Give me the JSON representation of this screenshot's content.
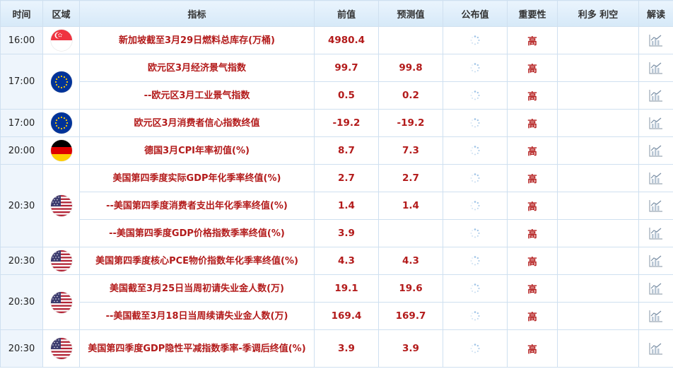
{
  "headers": {
    "time": "时间",
    "region": "区域",
    "indicator": "指标",
    "prev": "前值",
    "forecast": "预测值",
    "actual": "公布值",
    "importance": "重要性",
    "effect": "利多 利空",
    "interpret": "解读"
  },
  "rows": [
    {
      "time": "16:00",
      "flag": "sg-flag-icon",
      "indicator": "新加坡截至3月29日燃料总库存(万桶)",
      "prev": "4980.4",
      "forecast": "",
      "importance": "高"
    },
    {
      "time": "17:00",
      "flag": "eu-flag-icon",
      "indicator": "欧元区3月经济景气指数",
      "prev": "99.7",
      "forecast": "99.8",
      "importance": "高"
    },
    {
      "indicator": "--欧元区3月工业景气指数",
      "prev": "0.5",
      "forecast": "0.2",
      "importance": "高"
    },
    {
      "time": "17:00",
      "flag": "eu-flag-icon",
      "indicator": "欧元区3月消费者信心指数终值",
      "prev": "-19.2",
      "forecast": "-19.2",
      "importance": "高"
    },
    {
      "time": "20:00",
      "flag": "de-flag-icon",
      "indicator": "德国3月CPI年率初值(%)",
      "prev": "8.7",
      "forecast": "7.3",
      "importance": "高"
    },
    {
      "time": "20:30",
      "flag": "us-flag-icon",
      "indicator": "美国第四季度实际GDP年化季率终值(%)",
      "prev": "2.7",
      "forecast": "2.7",
      "importance": "高"
    },
    {
      "indicator": "--美国第四季度消费者支出年化季率终值(%)",
      "prev": "1.4",
      "forecast": "1.4",
      "importance": "高"
    },
    {
      "indicator": "--美国第四季度GDP价格指数季率终值(%)",
      "prev": "3.9",
      "forecast": "",
      "importance": "高"
    },
    {
      "time": "20:30",
      "flag": "us-flag-icon",
      "indicator": "美国第四季度核心PCE物价指数年化季率终值(%)",
      "prev": "4.3",
      "forecast": "4.3",
      "importance": "高"
    },
    {
      "time": "20:30",
      "flag": "us-flag-icon",
      "indicator": "美国截至3月25日当周初请失业金人数(万)",
      "prev": "19.1",
      "forecast": "19.6",
      "importance": "高"
    },
    {
      "indicator": "--美国截至3月18日当周续请失业金人数(万)",
      "prev": "169.4",
      "forecast": "169.7",
      "importance": "高"
    },
    {
      "time": "20:30",
      "flag": "us-flag-icon",
      "indicator": "美国第四季度GDP隐性平减指数季率-季调后终值(%)",
      "prev": "3.9",
      "forecast": "3.9",
      "importance": "高"
    }
  ],
  "colors": {
    "accent_red": "#b31b1b",
    "header_bg": "#dcecf9",
    "border": "#cfe0f0",
    "time_bg": "#eef5fc"
  }
}
